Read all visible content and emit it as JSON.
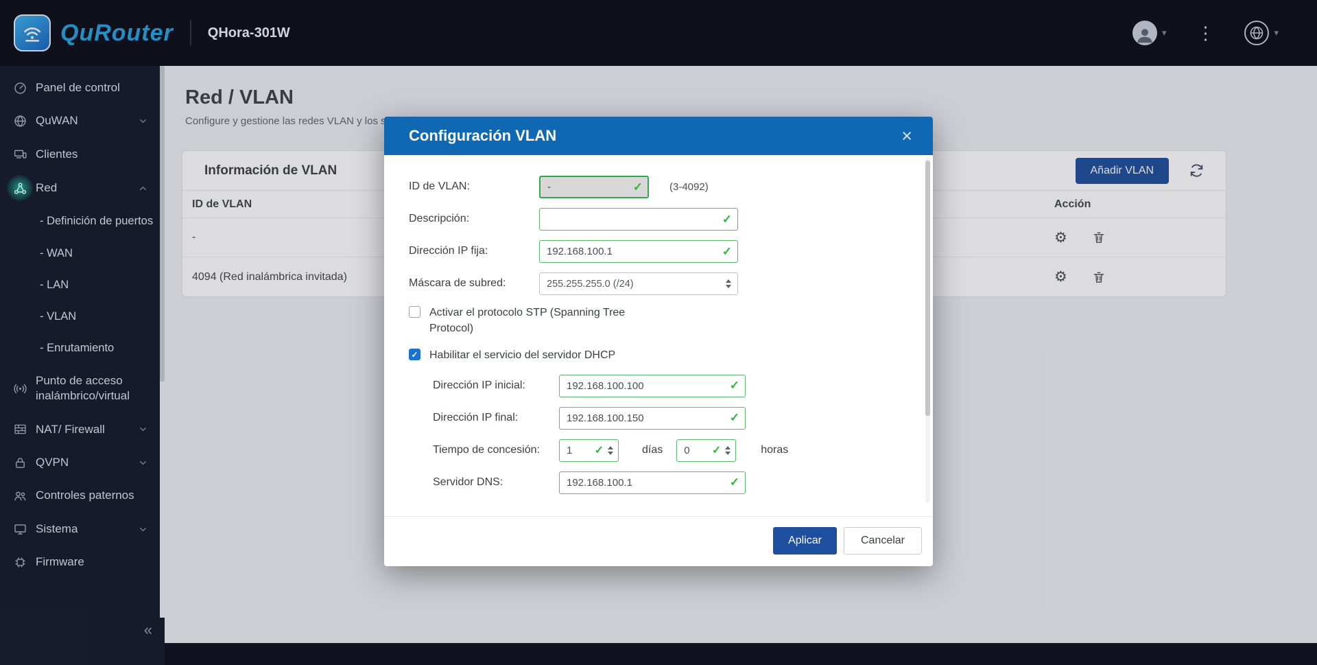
{
  "topbar": {
    "brand": "QuRouter",
    "device": "QHora-301W"
  },
  "icons": {
    "gear_glyph": "⚙",
    "check_glyph": "✓",
    "close_glyph": "×",
    "collapse_glyph": "«",
    "caret_glyph": "▾",
    "dots_glyph": "⋮"
  },
  "colors": {
    "brand_blue": "#27a3e2",
    "modal_header_blue": "#1067b2",
    "primary_button_blue": "#1e4f9e",
    "valid_green": "#2eb83a",
    "sidebar_dark": "#141a2b"
  },
  "sidebar": {
    "items": [
      {
        "label": "Panel de control"
      },
      {
        "label": "QuWAN"
      },
      {
        "label": "Clientes"
      },
      {
        "label": "Red"
      },
      {
        "label": "Punto de acceso inalámbrico/virtual"
      },
      {
        "label": "NAT/ Firewall"
      },
      {
        "label": "QVPN"
      },
      {
        "label": "Controles paternos"
      },
      {
        "label": "Sistema"
      },
      {
        "label": "Firmware"
      }
    ],
    "red_children": [
      {
        "label": "- Definición de puertos"
      },
      {
        "label": "- WAN"
      },
      {
        "label": "- LAN"
      },
      {
        "label": "- VLAN"
      },
      {
        "label": "- Enrutamiento"
      }
    ]
  },
  "page": {
    "title": "Red / VLAN",
    "subtitle": "Configure y gestione las redes VLAN y los servicios de servidor DHCP."
  },
  "card": {
    "title": "Información de VLAN",
    "add_button": "Añadir VLAN",
    "columns": {
      "id": "ID de VLAN",
      "action": "Acción"
    },
    "rows": [
      {
        "id": "-"
      },
      {
        "id": "4094 (Red inalámbrica invitada)"
      }
    ]
  },
  "modal": {
    "title": "Configuración VLAN",
    "vlan_id": {
      "label": "ID de VLAN:",
      "value": "-",
      "range": "(3-4092)"
    },
    "description": {
      "label": "Descripción:",
      "value": ""
    },
    "fixed_ip": {
      "label": "Dirección IP fija:",
      "value": "192.168.100.1"
    },
    "subnet_mask": {
      "label": "Máscara de subred:",
      "value": "255.255.255.0 (/24)"
    },
    "stp": {
      "label": "Activar el protocolo STP (Spanning Tree Protocol)",
      "checked": false
    },
    "dhcp": {
      "label": "Habilitar el servicio del servidor DHCP",
      "checked": true
    },
    "dhcp_start": {
      "label": "Dirección IP inicial:",
      "value": "192.168.100.100"
    },
    "dhcp_end": {
      "label": "Dirección IP final:",
      "value": "192.168.100.150"
    },
    "lease": {
      "label": "Tiempo de concesión:",
      "days_value": "1",
      "days_unit": "días",
      "hours_value": "0",
      "hours_unit": "horas"
    },
    "dns": {
      "label": "Servidor DNS:",
      "value": "192.168.100.1"
    },
    "apply_button": "Aplicar",
    "cancel_button": "Cancelar"
  }
}
